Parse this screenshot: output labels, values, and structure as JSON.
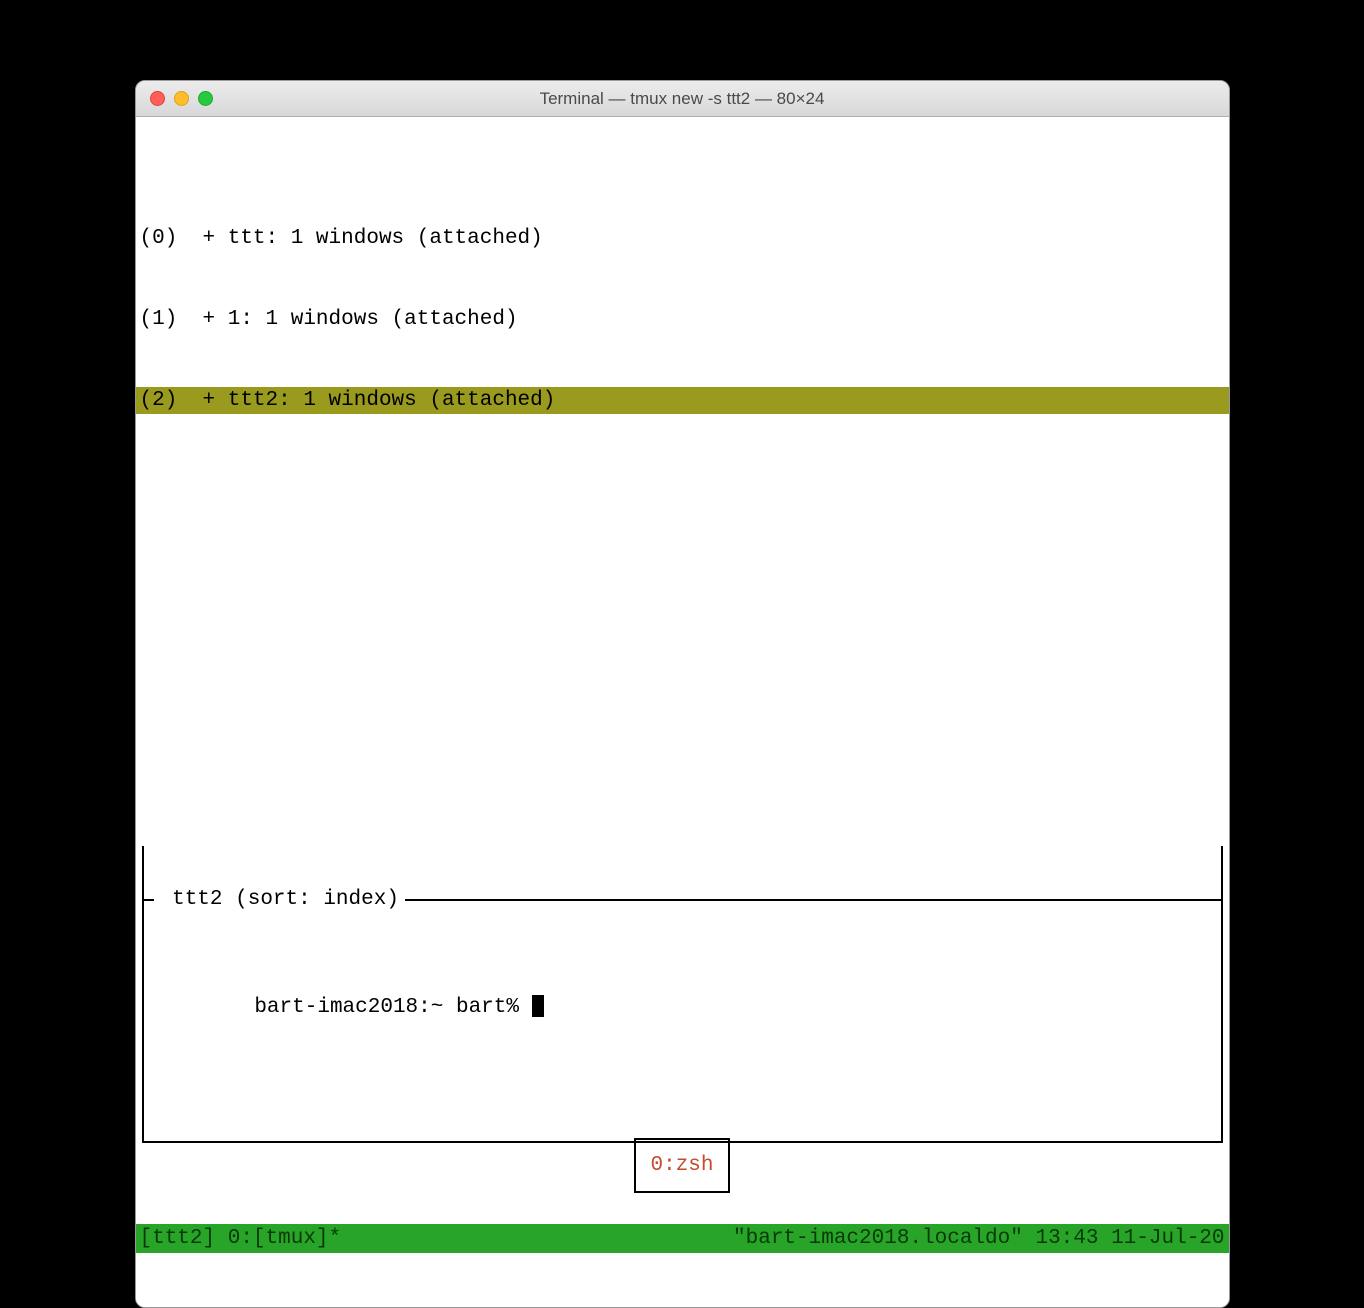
{
  "window": {
    "title": "Terminal — tmux new -s ttt2 — 80×24"
  },
  "sessions": [
    {
      "text": "(0)  + ttt: 1 windows (attached)",
      "selected": false
    },
    {
      "text": "(1)  + 1: 1 windows (attached)",
      "selected": false
    },
    {
      "text": "(2)  + ttt2: 1 windows (attached)",
      "selected": true
    }
  ],
  "preview": {
    "frame_label": " ttt2 (sort: index)",
    "prompt": "bart-imac2018:~ bart% ",
    "badge": "0:zsh"
  },
  "statusbar": {
    "left": "[ttt2] 0:[tmux]*",
    "right": "\"bart-imac2018.localdo\" 13:43 11-Jul-20"
  }
}
